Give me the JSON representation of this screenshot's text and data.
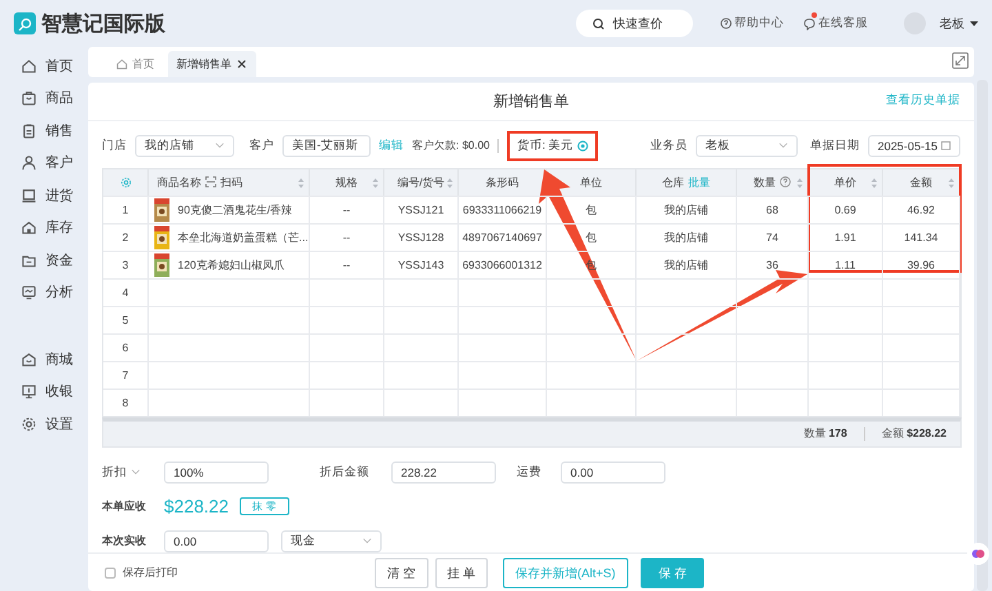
{
  "app": {
    "title": "智慧记国际版"
  },
  "header": {
    "search": "快速查价",
    "help": "帮助中心",
    "support": "在线客服",
    "support_alert": true,
    "user": "老板"
  },
  "sidebar": {
    "items": [
      {
        "label": "首页"
      },
      {
        "label": "商品"
      },
      {
        "label": "销售"
      },
      {
        "label": "客户"
      },
      {
        "label": "进货"
      },
      {
        "label": "库存"
      },
      {
        "label": "资金"
      },
      {
        "label": "分析"
      },
      {
        "label": "商城"
      },
      {
        "label": "收银"
      },
      {
        "label": "设置"
      }
    ]
  },
  "tabs": [
    {
      "label": "首页",
      "selected": false,
      "closable": false
    },
    {
      "label": "新增销售单",
      "selected": true,
      "closable": true
    }
  ],
  "form": {
    "title": "新增销售单",
    "history_link": "查看历史单据",
    "store_label": "门店",
    "store": "我的店铺",
    "customer_label": "客户",
    "customer": "美国-艾丽斯",
    "edit_link": "编辑",
    "debt": "客户欠款: $0.00",
    "currency": {
      "text": "货币: 美元",
      "highlighted": true
    },
    "salesman_label": "业务员",
    "salesman": "老板",
    "date_label": "单据日期",
    "date": "2025-05-15"
  },
  "table": {
    "highlight_frame": true,
    "columns": [
      {
        "kind": "settings",
        "sortable": false
      },
      {
        "label": "商品名称",
        "extra": "扫码",
        "kind": "scan",
        "sortable": true
      },
      {
        "label": "规格",
        "kind": "plain",
        "sortable": true
      },
      {
        "label": "编号/货号",
        "kind": "plain",
        "sortable": true
      },
      {
        "label": "条形码",
        "kind": "plain",
        "sortable": false
      },
      {
        "label": "单位",
        "kind": "plain",
        "sortable": false
      },
      {
        "label": "仓库",
        "extra": "批量",
        "kind": "link",
        "sortable": false
      },
      {
        "label": "数量",
        "kind": "help",
        "sortable": true
      },
      {
        "label": "单价",
        "kind": "plain",
        "sortable": true
      },
      {
        "label": "金额",
        "kind": "plain",
        "sortable": true
      }
    ],
    "rows": [
      {
        "picture": true,
        "cells": [
          "1",
          "90克傻二酒鬼花生/香辣",
          "--",
          "YSSJ121",
          "6933311066219",
          "包",
          "我的店铺",
          "68",
          "0.69",
          "46.92"
        ]
      },
      {
        "picture": true,
        "cells": [
          "2",
          "本垒北海道奶盖蛋糕（芒...",
          "--",
          "YSSJ128",
          "4897067140697",
          "包",
          "我的店铺",
          "74",
          "1.91",
          "141.34"
        ]
      },
      {
        "picture": true,
        "cells": [
          "3",
          "120克希媳妇山椒凤爪",
          "--",
          "YSSJ143",
          "6933066001312",
          "包",
          "我的店铺",
          "36",
          "1.11",
          "39.96"
        ]
      },
      {
        "picture": false,
        "cells": [
          "4"
        ]
      },
      {
        "picture": false,
        "cells": [
          "5"
        ]
      },
      {
        "picture": false,
        "cells": [
          "6"
        ]
      },
      {
        "picture": false,
        "cells": [
          "7"
        ]
      },
      {
        "picture": false,
        "cells": [
          "8"
        ]
      }
    ],
    "summary": [
      "数量 **178**",
      "金额 **$228.22**"
    ]
  },
  "totals": {
    "discount_label": "折扣",
    "discount": "100%",
    "after_label": "折后金额",
    "after": "228.22",
    "freight_label": "运费",
    "freight": "0.00",
    "receivable_label": "本单应收",
    "receivable": "$228.22",
    "round_button": "抹 零",
    "paid_label": "本次实收",
    "paid": "0.00",
    "method": "现金"
  },
  "actions": {
    "print_after_save": {
      "label": "保存后打印",
      "checked": false
    },
    "buttons": [
      {
        "label": "清 空",
        "kind": "plain"
      },
      {
        "label": "挂 单",
        "kind": "plain"
      },
      {
        "label": "保存并新增(Alt+S)",
        "kind": "outline"
      },
      {
        "label": "保 存",
        "kind": "primary"
      }
    ]
  },
  "annotations": [
    {
      "kind": "arrow"
    },
    {
      "kind": "arrow"
    }
  ]
}
